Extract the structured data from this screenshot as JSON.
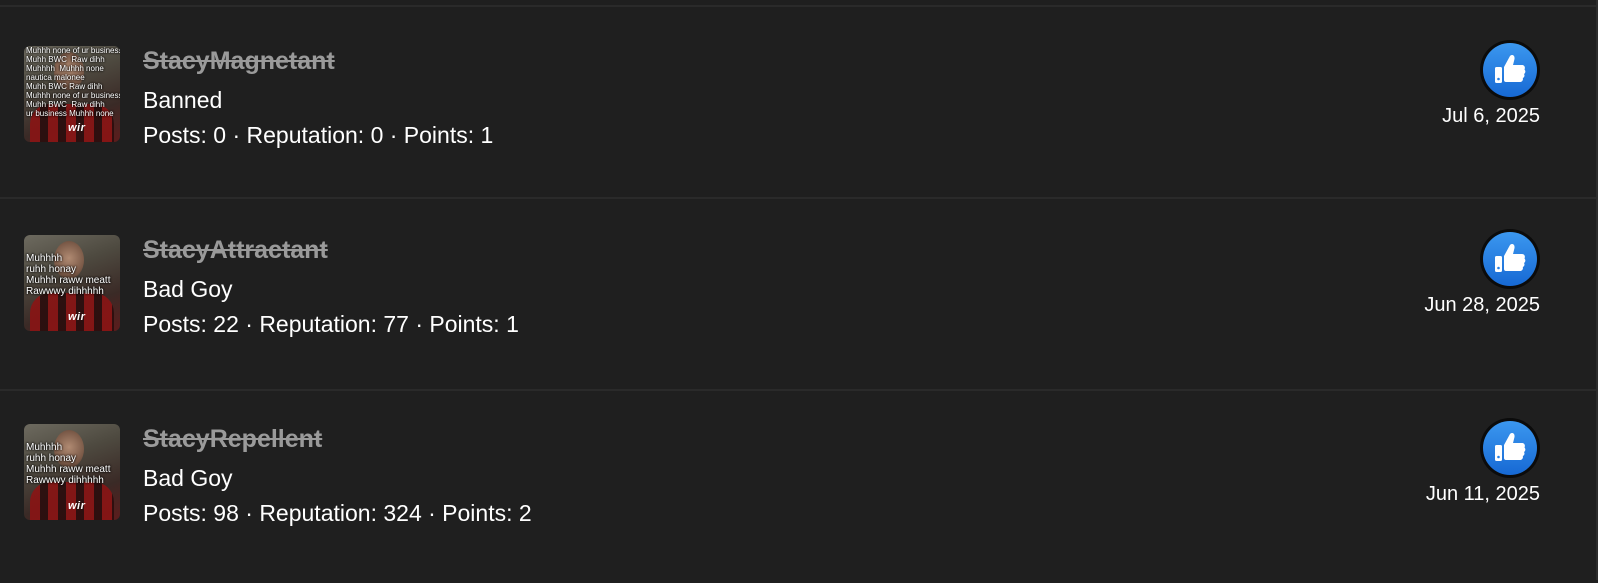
{
  "members": [
    {
      "username": "StacyMagnetant",
      "title": "Banned",
      "stats": "Posts: 0 · Reputation: 0 · Points: 1",
      "date": "Jul 6, 2025",
      "avatar_icon": "user-avatar-meme-collage",
      "avatar_text": "Muhhh none of ur business\nMuhh BWC  Raw dihh\nMuhhhh  Muhhh none\nnautica malonee\nMuhh BWC Raw dihh\nMuhhh none of ur business\nMuhh BWC  Raw dihh\nur business Muhhh none"
    },
    {
      "username": "StacyAttractant",
      "title": "Bad Goy",
      "stats": "Posts: 22 · Reputation: 77 · Points: 1",
      "date": "Jun 28, 2025",
      "avatar_icon": "user-avatar-meme",
      "avatar_text": "Muhhhh\nruhh honay\nMuhhh raww meatt\nRawwwy dihhhhh"
    },
    {
      "username": "StacyRepellent",
      "title": "Bad Goy",
      "stats": "Posts: 98 · Reputation: 324 · Points: 2",
      "date": "Jun 11, 2025",
      "avatar_icon": "user-avatar-meme",
      "avatar_text": "Muhhhh\nruhh honay\nMuhhh raww meatt\nRawwwy dihhhhh"
    }
  ],
  "avatar_shirt_text": "wir",
  "like_icon": "thumbs-up-icon",
  "colors": {
    "background": "#1f1f1f",
    "divider": "#2a2a2a",
    "username_banned": "#9a9a9a",
    "like_blue": "#2680e6"
  }
}
